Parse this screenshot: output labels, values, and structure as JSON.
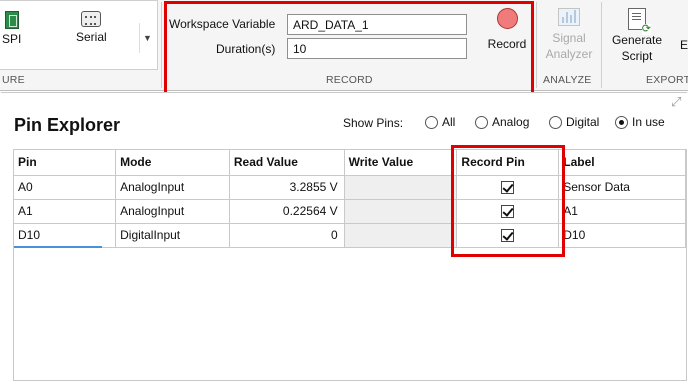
{
  "toolbar": {
    "connect_section_label": "URE",
    "spi_label": "SPI",
    "serial_label": "Serial",
    "record_section_label": "RECORD",
    "workspace_variable_label": "Workspace Variable",
    "workspace_variable_value": "ARD_DATA_1",
    "duration_label": "Duration(s)",
    "duration_value": "10",
    "record_label": "Record",
    "signal_analyzer_label_1": "Signal",
    "signal_analyzer_label_2": "Analyzer",
    "analyze_section_label": "ANALYZE",
    "generate_script_label_1": "Generate",
    "generate_script_label_2": "Script",
    "export_section_label": "EXPORT",
    "clipped_label": "E"
  },
  "pin_explorer": {
    "title": "Pin Explorer",
    "show_pins_label": "Show Pins:",
    "filters": [
      {
        "label": "All",
        "selected": false
      },
      {
        "label": "Analog",
        "selected": false
      },
      {
        "label": "Digital",
        "selected": false
      },
      {
        "label": "In use",
        "selected": true
      }
    ],
    "columns": [
      "Pin",
      "Mode",
      "Read Value",
      "Write Value",
      "Record Pin",
      "Label"
    ],
    "rows": [
      {
        "pin": "A0",
        "mode": "AnalogInput",
        "read_value": "3.2855 V",
        "write_value": "",
        "record": true,
        "label": "Sensor Data"
      },
      {
        "pin": "A1",
        "mode": "AnalogInput",
        "read_value": "0.22564 V",
        "write_value": "",
        "record": true,
        "label": "A1"
      },
      {
        "pin": "D10",
        "mode": "DigitalInput",
        "read_value": "0",
        "write_value": "",
        "record": true,
        "label": "D10"
      }
    ]
  },
  "colors": {
    "highlight_box": "#e00000",
    "record_button": "#f07b7b",
    "toolstrip_bg": "#f5f5f5"
  },
  "icons": {
    "spi": "spi-icon",
    "serial": "serial-port-icon",
    "record": "record-dot-icon",
    "signal_analyzer": "signal-analyzer-icon",
    "generate_script": "generate-script-icon",
    "expand": "expand-icon"
  }
}
